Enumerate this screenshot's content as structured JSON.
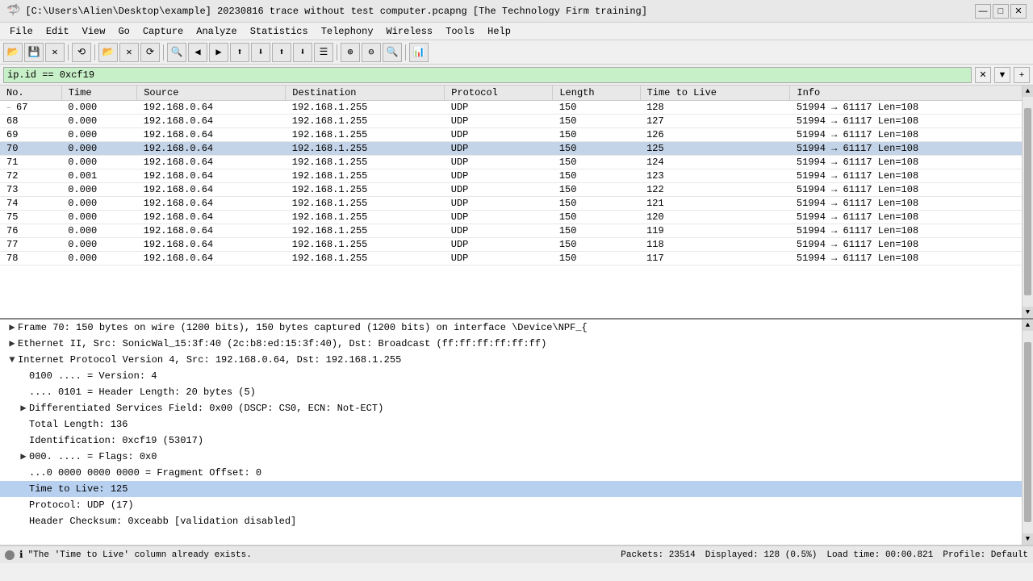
{
  "window": {
    "title": "[C:\\Users\\Alien\\Desktop\\example] 20230816 trace without test computer.pcapng [The Technology Firm training]",
    "icon": "🦈"
  },
  "titlebar": {
    "minimize": "—",
    "maximize": "□",
    "close": "✕"
  },
  "menu": {
    "items": [
      "File",
      "Edit",
      "View",
      "Go",
      "Capture",
      "Analyze",
      "Statistics",
      "Telephony",
      "Wireless",
      "Tools",
      "Help"
    ]
  },
  "toolbar": {
    "buttons": [
      "📁",
      "💾",
      "✕",
      "⟲",
      "📂",
      "✕",
      "⟳",
      "🔍",
      "◀",
      "▶",
      "⬆",
      "⬇",
      "=",
      "↕",
      "☰",
      "🔍",
      "🔍±",
      "⊕",
      "📊"
    ]
  },
  "filter": {
    "value": "ip.id == 0xcf19",
    "clear_label": "✕",
    "arrow_label": "▼",
    "add_label": "+"
  },
  "columns": [
    "No.",
    "Time",
    "Source",
    "Destination",
    "Protocol",
    "Length",
    "Time to Live",
    "Info"
  ],
  "packets": [
    {
      "no": "67",
      "time": "0.000",
      "source": "192.168.0.64",
      "dest": "192.168.1.255",
      "proto": "UDP",
      "len": "150",
      "ttl": "128",
      "info": "51994 → 61117  Len=108",
      "marker": "–"
    },
    {
      "no": "68",
      "time": "0.000",
      "source": "192.168.0.64",
      "dest": "192.168.1.255",
      "proto": "UDP",
      "len": "150",
      "ttl": "127",
      "info": "51994 → 61117  Len=108",
      "marker": ""
    },
    {
      "no": "69",
      "time": "0.000",
      "source": "192.168.0.64",
      "dest": "192.168.1.255",
      "proto": "UDP",
      "len": "150",
      "ttl": "126",
      "info": "51994 → 61117  Len=108",
      "marker": ""
    },
    {
      "no": "70",
      "time": "0.000",
      "source": "192.168.0.64",
      "dest": "192.168.1.255",
      "proto": "UDP",
      "len": "150",
      "ttl": "125",
      "info": "51994 → 61117  Len=108",
      "marker": "",
      "selected": true
    },
    {
      "no": "71",
      "time": "0.000",
      "source": "192.168.0.64",
      "dest": "192.168.1.255",
      "proto": "UDP",
      "len": "150",
      "ttl": "124",
      "info": "51994 → 61117  Len=108",
      "marker": ""
    },
    {
      "no": "72",
      "time": "0.001",
      "source": "192.168.0.64",
      "dest": "192.168.1.255",
      "proto": "UDP",
      "len": "150",
      "ttl": "123",
      "info": "51994 → 61117  Len=108",
      "marker": ""
    },
    {
      "no": "73",
      "time": "0.000",
      "source": "192.168.0.64",
      "dest": "192.168.1.255",
      "proto": "UDP",
      "len": "150",
      "ttl": "122",
      "info": "51994 → 61117  Len=108",
      "marker": ""
    },
    {
      "no": "74",
      "time": "0.000",
      "source": "192.168.0.64",
      "dest": "192.168.1.255",
      "proto": "UDP",
      "len": "150",
      "ttl": "121",
      "info": "51994 → 61117  Len=108",
      "marker": ""
    },
    {
      "no": "75",
      "time": "0.000",
      "source": "192.168.0.64",
      "dest": "192.168.1.255",
      "proto": "UDP",
      "len": "150",
      "ttl": "120",
      "info": "51994 → 61117  Len=108",
      "marker": ""
    },
    {
      "no": "76",
      "time": "0.000",
      "source": "192.168.0.64",
      "dest": "192.168.1.255",
      "proto": "UDP",
      "len": "150",
      "ttl": "119",
      "info": "51994 → 61117  Len=108",
      "marker": ""
    },
    {
      "no": "77",
      "time": "0.000",
      "source": "192.168.0.64",
      "dest": "192.168.1.255",
      "proto": "UDP",
      "len": "150",
      "ttl": "118",
      "info": "51994 → 61117  Len=108",
      "marker": ""
    },
    {
      "no": "78",
      "time": "0.000",
      "source": "192.168.0.64",
      "dest": "192.168.1.255",
      "proto": "UDP",
      "len": "150",
      "ttl": "117",
      "info": "51994 → 61117  Len=108",
      "marker": ""
    }
  ],
  "details": [
    {
      "indent": 0,
      "toggle": "▶",
      "text": "Frame 70: 150 bytes on wire (1200 bits), 150 bytes captured (1200 bits) on interface \\Device\\NPF_{",
      "highlighted": false
    },
    {
      "indent": 0,
      "toggle": "▶",
      "text": "Ethernet II, Src: SonicWal_15:3f:40 (2c:b8:ed:15:3f:40), Dst: Broadcast (ff:ff:ff:ff:ff:ff)",
      "highlighted": false
    },
    {
      "indent": 0,
      "toggle": "▼",
      "text": "Internet Protocol Version 4, Src: 192.168.0.64, Dst: 192.168.1.255",
      "highlighted": false
    },
    {
      "indent": 1,
      "toggle": "",
      "text": "0100 .... = Version: 4",
      "highlighted": false
    },
    {
      "indent": 1,
      "toggle": "",
      "text": ".... 0101 = Header Length: 20 bytes (5)",
      "highlighted": false
    },
    {
      "indent": 1,
      "toggle": "▶",
      "text": "Differentiated Services Field: 0x00 (DSCP: CS0, ECN: Not-ECT)",
      "highlighted": false
    },
    {
      "indent": 1,
      "toggle": "",
      "text": "Total Length: 136",
      "highlighted": false
    },
    {
      "indent": 1,
      "toggle": "",
      "text": "Identification: 0xcf19 (53017)",
      "highlighted": false
    },
    {
      "indent": 1,
      "toggle": "▶",
      "text": "000. .... = Flags: 0x0",
      "highlighted": false
    },
    {
      "indent": 1,
      "toggle": "",
      "text": "...0 0000 0000 0000 = Fragment Offset: 0",
      "highlighted": false
    },
    {
      "indent": 1,
      "toggle": "",
      "text": "Time to Live: 125",
      "highlighted": true
    },
    {
      "indent": 1,
      "toggle": "",
      "text": "Protocol: UDP (17)",
      "highlighted": false
    },
    {
      "indent": 1,
      "toggle": "",
      "text": "Header Checksum: 0xceabb [validation disabled]",
      "highlighted": false
    }
  ],
  "statusbar": {
    "status_text": "\"The 'Time to Live' column already exists.",
    "packets_label": "Packets: 23514",
    "displayed_label": "Displayed: 128 (0.5%)",
    "load_label": "Load time: 00:00.821",
    "profile_label": "Profile: Default"
  }
}
